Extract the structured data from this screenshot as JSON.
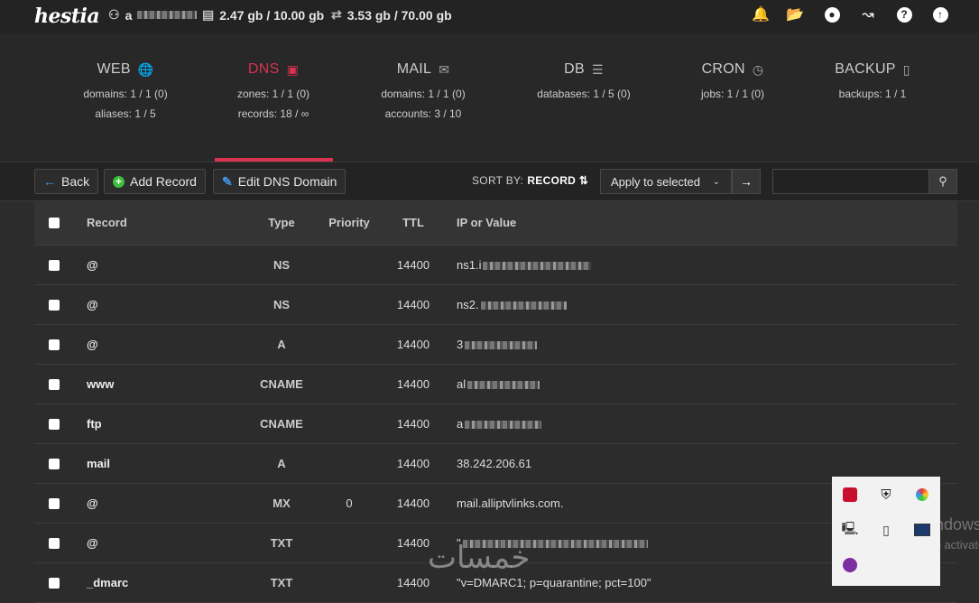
{
  "topbar": {
    "logo": "hestia",
    "user": "a",
    "disk": "2.47 gb / 10.00 gb",
    "bandwidth": "3.53 gb / 70.00 gb",
    "icons": [
      "bell-icon",
      "folder-icon",
      "user-icon",
      "stats-icon",
      "help-icon",
      "update-icon"
    ]
  },
  "nav": {
    "tabs": [
      {
        "label": "WEB",
        "icon": "globe-icon",
        "line1": "domains: 1 / 1 (0)",
        "line2": "aliases: 1 / 5"
      },
      {
        "label": "DNS",
        "icon": "dns-icon",
        "line1": "zones: 1 / 1 (0)",
        "line2": "records: 18 / ∞"
      },
      {
        "label": "MAIL",
        "icon": "mail-icon",
        "line1": "domains: 1 / 1 (0)",
        "line2": "accounts: 3 / 10"
      },
      {
        "label": "DB",
        "icon": "database-icon",
        "line1": "databases: 1 / 5 (0)",
        "line2": ""
      },
      {
        "label": "CRON",
        "icon": "clock-icon",
        "line1": "jobs: 1 / 1 (0)",
        "line2": ""
      },
      {
        "label": "BACKUP",
        "icon": "file-icon",
        "line1": "backups: 1 / 1",
        "line2": ""
      }
    ],
    "active": "DNS",
    "accent": "#d9324f"
  },
  "toolbar": {
    "back_label": "Back",
    "add_label": "Add Record",
    "edit_label": "Edit DNS Domain",
    "sort_prefix": "SORT BY:",
    "sort_value": "RECORD",
    "bulk_select": "Apply to selected",
    "search_placeholder": ""
  },
  "table": {
    "headers": {
      "record": "Record",
      "type": "Type",
      "priority": "Priority",
      "ttl": "TTL",
      "value": "IP or Value"
    },
    "rows": [
      {
        "record": "@",
        "type": "NS",
        "priority": "",
        "ttl": "14400",
        "value": "ns1.i",
        "blur": 120
      },
      {
        "record": "@",
        "type": "NS",
        "priority": "",
        "ttl": "14400",
        "value": "ns2.",
        "blur": 95
      },
      {
        "record": "@",
        "type": "A",
        "priority": "",
        "ttl": "14400",
        "value": "3",
        "blur": 80
      },
      {
        "record": "www",
        "type": "CNAME",
        "priority": "",
        "ttl": "14400",
        "value": "al",
        "blur": 80
      },
      {
        "record": "ftp",
        "type": "CNAME",
        "priority": "",
        "ttl": "14400",
        "value": "a",
        "blur": 85
      },
      {
        "record": "mail",
        "type": "A",
        "priority": "",
        "ttl": "14400",
        "value": "38.242.206.61",
        "blur": 0
      },
      {
        "record": "@",
        "type": "MX",
        "priority": "0",
        "ttl": "14400",
        "value": "mail.alliptvlinks.com.",
        "blur": 0
      },
      {
        "record": "@",
        "type": "TXT",
        "priority": "",
        "ttl": "14400",
        "value": "\"",
        "blur": 205
      },
      {
        "record": "_dmarc",
        "type": "TXT",
        "priority": "",
        "ttl": "14400",
        "value": "\"v=DMARC1; p=quarantine; pct=100\"",
        "blur": 0
      }
    ]
  },
  "overlay": {
    "win_line1": "Activate Windows",
    "win_line2": "Go to Settings to activate",
    "arabic_watermark": "خمسات"
  }
}
